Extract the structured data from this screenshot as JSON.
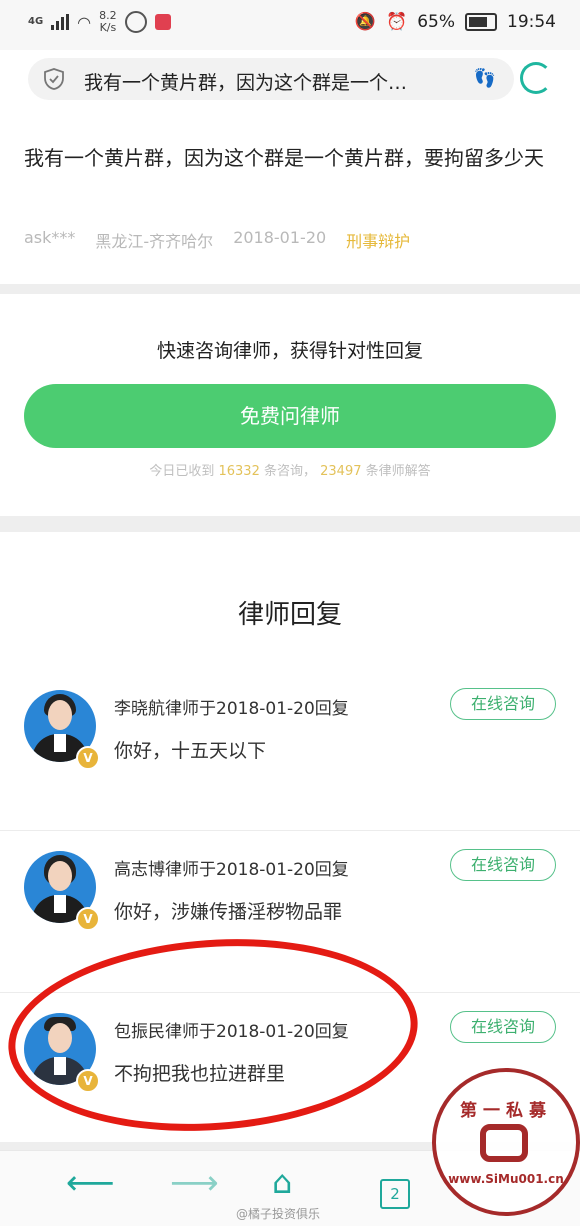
{
  "status_bar": {
    "network": "4G",
    "speed_value": "8.2",
    "speed_unit": "K/s",
    "battery": "65%",
    "time": "19:54"
  },
  "search": {
    "query": "我有一个黄片群，因为这个群是一个…"
  },
  "question": {
    "title": "我有一个黄片群，因为这个群是一个黄片群，要拘留多少天",
    "user": "ask***",
    "location": "黑龙江-齐齐哈尔",
    "date": "2018-01-20",
    "tag": "刑事辩护"
  },
  "consult": {
    "headline": "快速咨询律师，获得针对性回复",
    "button": "免费问律师",
    "stats_prefix": "今日已收到",
    "stats_count1": "16332",
    "stats_mid": "条咨询，",
    "stats_count2": "23497",
    "stats_suffix": "条律师解答"
  },
  "replies": {
    "heading": "律师回复",
    "items": [
      {
        "name": "李晓航律师于2018-01-20回复",
        "text": "你好，十五天以下",
        "button": "在线咨询"
      },
      {
        "name": "高志博律师于2018-01-20回复",
        "text": "你好，涉嫌传播淫秽物品罪",
        "button": "在线咨询"
      },
      {
        "name": "包振民律师于2018-01-20回复",
        "text": "不拘把我也拉进群里",
        "button": "在线咨询"
      }
    ]
  },
  "navbar": {
    "tab_count": "2",
    "weibo_watermark": "@橘子投资俱乐"
  },
  "stamp": {
    "top_text": "第一私募",
    "url": "www.SiMu001.cn"
  },
  "colors": {
    "accent_green": "#4ccc71",
    "teal": "#1fa89b",
    "annotation_red": "#e41b13",
    "tag_gold": "#e6b93a"
  }
}
